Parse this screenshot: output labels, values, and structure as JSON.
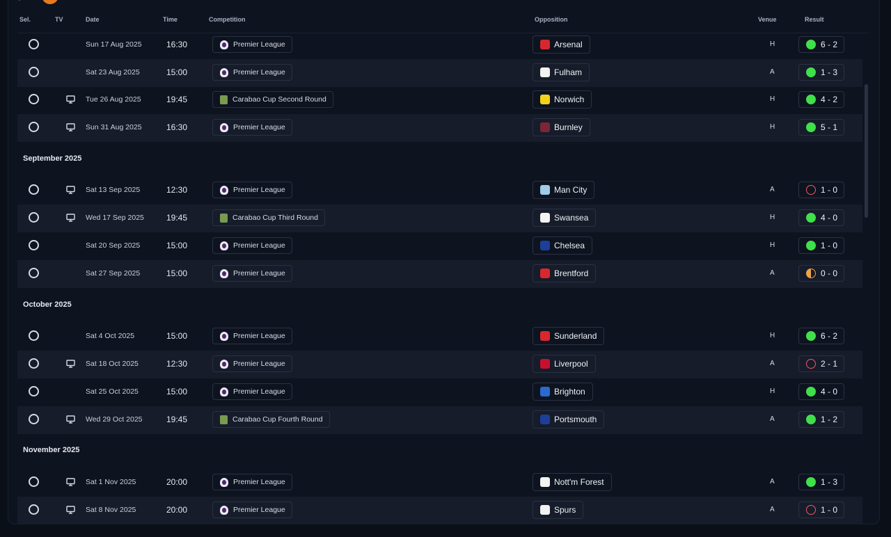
{
  "header": {
    "sel": "Sel.",
    "tv": "TV",
    "date": "Date",
    "time": "Time",
    "competition": "Competition",
    "opposition": "Opposition",
    "venue": "Venue",
    "result": "Result"
  },
  "months": [
    "September 2025",
    "October 2025",
    "November 2025"
  ],
  "colors": {
    "win": "#3fe04a",
    "loss": "#f05a66",
    "draw": "#f0a24a"
  },
  "fixtures": [
    {
      "tv": false,
      "date": "Sun 17 Aug 2025",
      "time": "16:30",
      "competition": "Premier League",
      "comp_icon": "premier-league-icon",
      "opposition": "Arsenal",
      "crest": "arsenal-crest-icon",
      "crest_color": "#d8282e",
      "venue": "H",
      "result": "6 - 2",
      "outcome": "win"
    },
    {
      "tv": false,
      "date": "Sat 23 Aug 2025",
      "time": "15:00",
      "competition": "Premier League",
      "comp_icon": "premier-league-icon",
      "opposition": "Fulham",
      "crest": "fulham-crest-icon",
      "crest_color": "#f2f2f2",
      "venue": "A",
      "result": "1 - 3",
      "outcome": "win"
    },
    {
      "tv": true,
      "date": "Tue 26 Aug 2025",
      "time": "19:45",
      "competition": "Carabao Cup Second Round",
      "comp_icon": "carabao-cup-icon",
      "opposition": "Norwich",
      "crest": "norwich-crest-icon",
      "crest_color": "#f4d21a",
      "venue": "H",
      "result": "4 - 2",
      "outcome": "win"
    },
    {
      "tv": true,
      "date": "Sun 31 Aug 2025",
      "time": "16:30",
      "competition": "Premier League",
      "comp_icon": "premier-league-icon",
      "opposition": "Burnley",
      "crest": "burnley-crest-icon",
      "crest_color": "#7a2638",
      "venue": "H",
      "result": "5 - 1",
      "outcome": "win"
    },
    {
      "tv": true,
      "date": "Sat 13 Sep 2025",
      "time": "12:30",
      "competition": "Premier League",
      "comp_icon": "premier-league-icon",
      "opposition": "Man City",
      "crest": "man-city-crest-icon",
      "crest_color": "#9fcbe8",
      "venue": "A",
      "result": "1 - 0",
      "outcome": "loss"
    },
    {
      "tv": true,
      "date": "Wed 17 Sep 2025",
      "time": "19:45",
      "competition": "Carabao Cup Third Round",
      "comp_icon": "carabao-cup-icon",
      "opposition": "Swansea",
      "crest": "swansea-crest-icon",
      "crest_color": "#f2f2f2",
      "venue": "H",
      "result": "4 - 0",
      "outcome": "win"
    },
    {
      "tv": false,
      "date": "Sat 20 Sep 2025",
      "time": "15:00",
      "competition": "Premier League",
      "comp_icon": "premier-league-icon",
      "opposition": "Chelsea",
      "crest": "chelsea-crest-icon",
      "crest_color": "#1d3f9a",
      "venue": "H",
      "result": "1 - 0",
      "outcome": "win"
    },
    {
      "tv": false,
      "date": "Sat 27 Sep 2025",
      "time": "15:00",
      "competition": "Premier League",
      "comp_icon": "premier-league-icon",
      "opposition": "Brentford",
      "crest": "brentford-crest-icon",
      "crest_color": "#d8282e",
      "venue": "A",
      "result": "0 - 0",
      "outcome": "draw"
    },
    {
      "tv": false,
      "date": "Sat 4 Oct 2025",
      "time": "15:00",
      "competition": "Premier League",
      "comp_icon": "premier-league-icon",
      "opposition": "Sunderland",
      "crest": "sunderland-crest-icon",
      "crest_color": "#d8282e",
      "venue": "H",
      "result": "6 - 2",
      "outcome": "win"
    },
    {
      "tv": true,
      "date": "Sat 18 Oct 2025",
      "time": "12:30",
      "competition": "Premier League",
      "comp_icon": "premier-league-icon",
      "opposition": "Liverpool",
      "crest": "liverpool-crest-icon",
      "crest_color": "#c8102e",
      "venue": "A",
      "result": "2 - 1",
      "outcome": "loss"
    },
    {
      "tv": false,
      "date": "Sat 25 Oct 2025",
      "time": "15:00",
      "competition": "Premier League",
      "comp_icon": "premier-league-icon",
      "opposition": "Brighton",
      "crest": "brighton-crest-icon",
      "crest_color": "#2a6ad0",
      "venue": "H",
      "result": "4 - 0",
      "outcome": "win"
    },
    {
      "tv": true,
      "date": "Wed 29 Oct 2025",
      "time": "19:45",
      "competition": "Carabao Cup Fourth Round",
      "comp_icon": "carabao-cup-icon",
      "opposition": "Portsmouth",
      "crest": "portsmouth-crest-icon",
      "crest_color": "#1d3f9a",
      "venue": "A",
      "result": "1 - 2",
      "outcome": "win"
    },
    {
      "tv": true,
      "date": "Sat 1 Nov 2025",
      "time": "20:00",
      "competition": "Premier League",
      "comp_icon": "premier-league-icon",
      "opposition": "Nott'm Forest",
      "crest": "nottm-forest-crest-icon",
      "crest_color": "#f2f2f2",
      "venue": "A",
      "result": "1 - 3",
      "outcome": "win"
    },
    {
      "tv": true,
      "date": "Sat 8 Nov 2025",
      "time": "20:00",
      "competition": "Premier League",
      "comp_icon": "premier-league-icon",
      "opposition": "Spurs",
      "crest": "spurs-crest-icon",
      "crest_color": "#f2f2f2",
      "venue": "A",
      "result": "1 - 0",
      "outcome": "loss"
    }
  ]
}
